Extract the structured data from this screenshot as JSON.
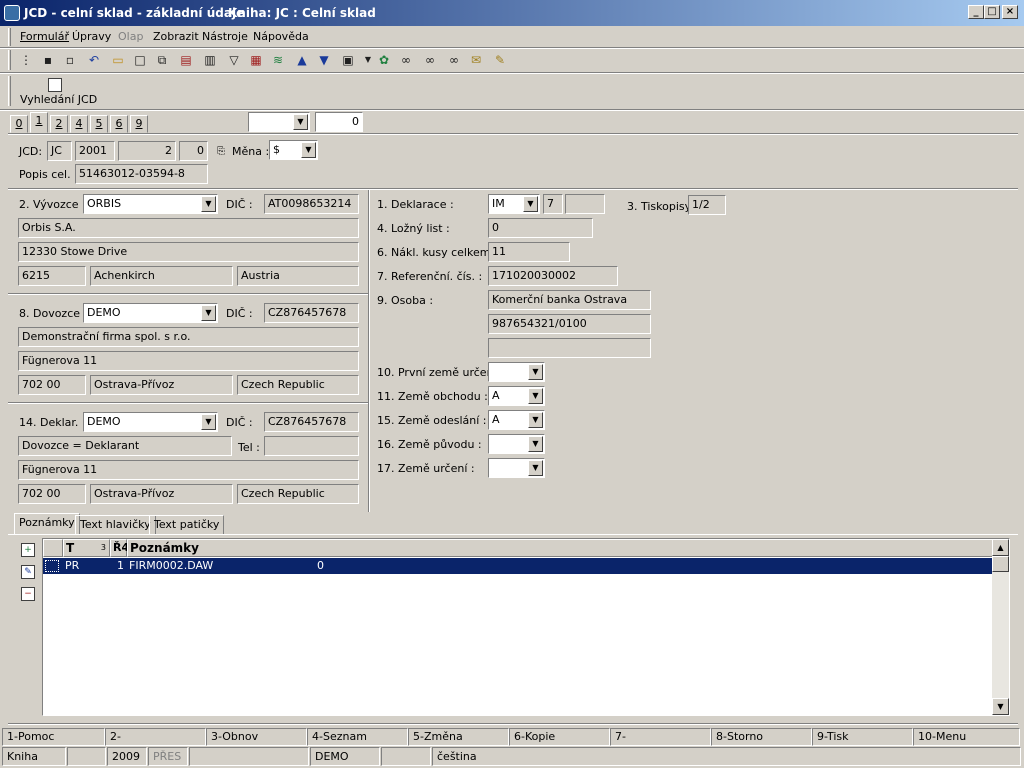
{
  "window": {
    "title_left": "JCD - celní sklad - základní údaje",
    "title_right": "Kniha: JC : Celní sklad",
    "min": "_",
    "max": "□",
    "close": "×"
  },
  "menu": [
    "Formulář",
    "Úpravy",
    "Olap",
    "Zobrazit",
    "Nástroje",
    "Nápověda"
  ],
  "toolbar2": {
    "search_label": "Vyhledání JCD"
  },
  "tabs": [
    "0",
    "1",
    "2",
    "4",
    "5",
    "6",
    "9"
  ],
  "top_combo": {
    "value": ""
  },
  "top_field": {
    "value": "0"
  },
  "header": {
    "jcd_label": "JCD:",
    "jcd_type": "JC",
    "jcd_year": "2001",
    "jcd_num": "2",
    "jcd_sub": "0",
    "mena_label": "Měna :",
    "mena": "$",
    "popis_label": "Popis cel. :",
    "popis": "51463012-03594-8"
  },
  "vyvozce": {
    "label": "2. Vývozce :",
    "code": "ORBIS",
    "dic_label": "DIČ :",
    "dic": "AT0098653214",
    "name": "Orbis S.A.",
    "street": "12330 Stowe Drive",
    "zip": "6215",
    "city": "Achenkirch",
    "country": "Austria"
  },
  "dovozce": {
    "label": "8. Dovozce :",
    "code": "DEMO",
    "dic_label": "DIČ :",
    "dic": "CZ876457678",
    "name": "Demonstrační firma spol. s r.o.",
    "street": "Fügnerova 11",
    "zip": "702 00",
    "city": "Ostrava-Přívoz",
    "country": "Czech Republic"
  },
  "deklarant": {
    "label": "14. Deklar. :",
    "code": "DEMO",
    "dic_label": "DIČ :",
    "dic": "CZ876457678",
    "name": "Dovozce = Deklarant",
    "tel_label": "Tel :",
    "tel": "",
    "street": "Fügnerova 11",
    "zip": "702 00",
    "city": "Ostrava-Přívoz",
    "country": "Czech Republic"
  },
  "right": {
    "deklarace_label": "1. Deklarace :",
    "deklarace_type": "IM",
    "deklarace_num": "7",
    "deklarace_extra": "",
    "tiskopisy_label": "3. Tiskopisy:",
    "tiskopisy": "1/2",
    "lozny_label": "4. Ložný list :",
    "lozny": "0",
    "kusy_label": "6. Nákl. kusy celkem :",
    "kusy": "11",
    "ref_label": "7. Referenční. čís. :",
    "ref": "171020030002",
    "osoba_label": "9. Osoba :",
    "osoba1": "Komerční banka Ostrava",
    "osoba2": "987654321/0100",
    "osoba3": "",
    "prvni_label": "10. První země určení :",
    "prvni": "",
    "obchodu_label": "11. Země obchodu :",
    "obchodu": "A",
    "odeslani_label": "15. Země  odeslání :",
    "odeslani": "A",
    "puvodu_label": "16. Země původu :",
    "puvodu": "",
    "urceni_label": "17. Země určení :",
    "urceni": ""
  },
  "bottom_tabs": [
    "Poznámky",
    "Text hlavičky",
    "Text patičky"
  ],
  "grid": {
    "col_t": "T",
    "col_sort": "3",
    "col_r": "Ř4",
    "col_pozn": "Poznámky",
    "rows": [
      {
        "t": "PR",
        "r": "1",
        "pozn": "FIRM0002.DAW",
        "val": "0"
      }
    ]
  },
  "fkeys": [
    "1-Pomoc",
    "2-",
    "3-Obnov",
    "4-Seznam",
    "5-Změna",
    "6-Kopie",
    "7-",
    "8-Storno",
    "9-Tisk",
    "10-Menu"
  ],
  "status": {
    "kniha": "Kniha",
    "blank1": "",
    "year": "2009",
    "pres": "PŘES",
    "blank2": "",
    "user": "DEMO",
    "blank3": "",
    "lang": "čeština"
  }
}
